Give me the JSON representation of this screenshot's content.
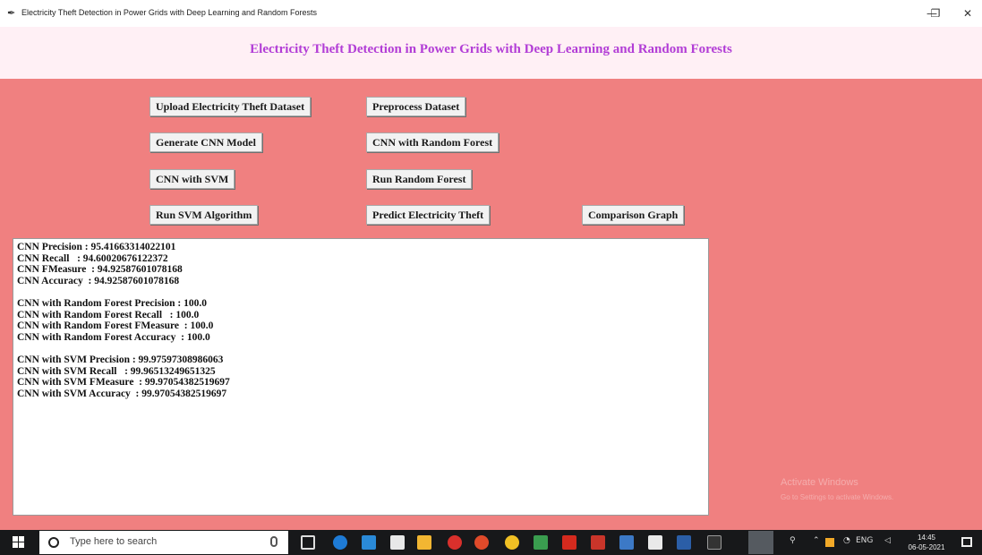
{
  "window": {
    "title": "Electricity Theft Detection in Power Grids with Deep Learning and Random Forests",
    "minimize_glyph": "—",
    "maximize_glyph": "❐",
    "close_glyph": "✕"
  },
  "header": {
    "title": "Electricity Theft Detection in Power Grids with Deep Learning and Random Forests"
  },
  "buttons": {
    "upload": "Upload Electricity Theft Dataset",
    "preprocess": "Preprocess Dataset",
    "generate_cnn": "Generate CNN Model",
    "cnn_rf": "CNN with Random Forest",
    "cnn_svm": "CNN with SVM",
    "run_rf": "Run Random Forest",
    "run_svm": "Run SVM Algorithm",
    "predict": "Predict Electricity Theft",
    "comparison": "Comparison Graph"
  },
  "output": {
    "lines": [
      "CNN Precision : 95.41663314022101",
      "CNN Recall   : 94.60020676122372",
      "CNN FMeasure  : 94.92587601078168",
      "CNN Accuracy  : 94.92587601078168",
      "",
      "CNN with Random Forest Precision : 100.0",
      "CNN with Random Forest Recall   : 100.0",
      "CNN with Random Forest FMeasure  : 100.0",
      "CNN with Random Forest Accuracy  : 100.0",
      "",
      "CNN with SVM Precision : 99.97597308986063",
      "CNN with SVM Recall   : 99.96513249651325",
      "CNN with SVM FMeasure  : 99.97054382519697",
      "CNN with SVM Accuracy  : 99.97054382519697"
    ]
  },
  "watermark": {
    "line1": "Activate Windows",
    "line2": "Go to Settings to activate Windows."
  },
  "taskbar": {
    "search_placeholder": "Type here to search",
    "clock_time": "14:45",
    "clock_date": "06-05-2021",
    "tray_text": "ENG"
  },
  "colors": {
    "background": "#f08080",
    "header_bg": "#fff0f5",
    "title_color": "#b23dd6"
  }
}
